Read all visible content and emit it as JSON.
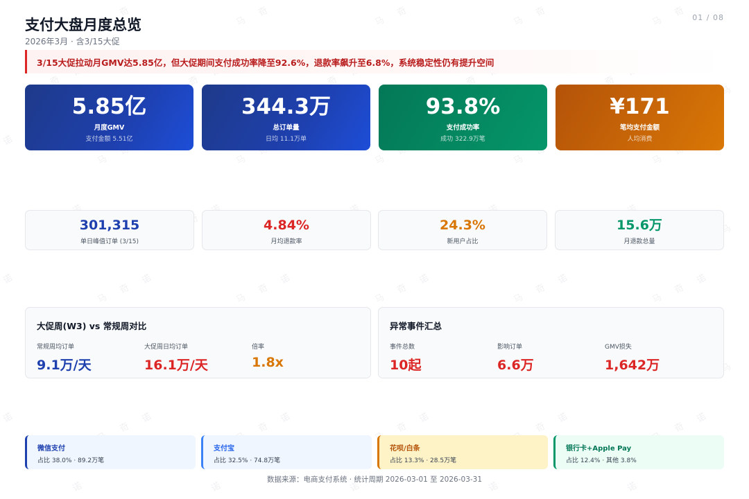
{
  "header": {
    "title": "支付大盘月度总览",
    "subtitle": "2026年3月 · 含3/15大促",
    "pager": "01 / 08"
  },
  "alert": "3/15大促拉动月GMV达5.85亿，但大促期间支付成功率降至92.6%，退款率飙升至6.8%，系统稳定性仍有提升空间",
  "kpis": [
    {
      "value": "5.85亿",
      "label": "月度GMV",
      "sub": "支付金额 5.51亿"
    },
    {
      "value": "344.3万",
      "label": "总订单量",
      "sub": "日均 11.1万单"
    },
    {
      "value": "93.8%",
      "label": "支付成功率",
      "sub": "成功 322.9万笔"
    },
    {
      "value": "¥171",
      "label": "笔均支付金额",
      "sub": "人均消费"
    }
  ],
  "metrics": [
    {
      "value": "301,315",
      "label": "单日峰值订单 (3/15)"
    },
    {
      "value": "4.84%",
      "label": "月均退款率"
    },
    {
      "value": "24.3%",
      "label": "新用户占比"
    },
    {
      "value": "15.6万",
      "label": "月退款总量"
    }
  ],
  "promo": {
    "title": "大促周(W3) vs 常规周对比",
    "items": [
      {
        "label": "常规周均订单",
        "value": "9.1万/天"
      },
      {
        "label": "大促周日均订单",
        "value": "16.1万/天"
      },
      {
        "label": "倍率",
        "value": "1.8x"
      }
    ]
  },
  "incidents": {
    "title": "异常事件汇总",
    "items": [
      {
        "label": "事件总数",
        "value": "10起"
      },
      {
        "label": "影响订单",
        "value": "6.6万"
      },
      {
        "label": "GMV损失",
        "value": "1,642万"
      }
    ]
  },
  "channels": [
    {
      "name": "微信支付",
      "desc": "占比 38.0% · 89.2万笔"
    },
    {
      "name": "支付宝",
      "desc": "占比 32.5% · 74.8万笔"
    },
    {
      "name": "花呗/白条",
      "desc": "占比 13.3% · 28.5万笔"
    },
    {
      "name": "银行卡+Apple Pay",
      "desc": "占比 12.4% · 其他 3.8%"
    }
  ],
  "footer": "数据来源：电商支付系统 · 统计周期 2026-03-01 至 2026-03-31",
  "watermark": "马奇诺",
  "colors": {
    "navy": "#1e3a8a",
    "red": "#dc2626",
    "orange": "#d97706",
    "green": "#059669",
    "blue": "#1e40af"
  }
}
